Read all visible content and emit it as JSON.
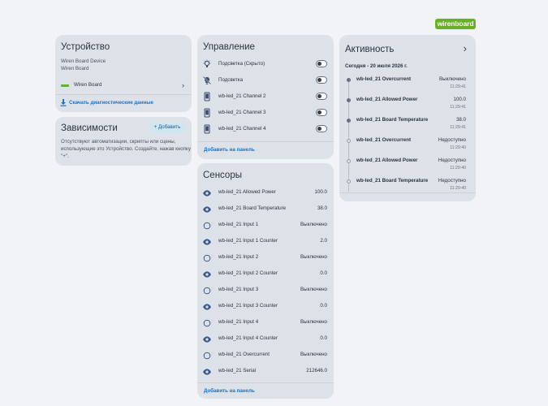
{
  "logo": {
    "text": "wirenboard",
    "color": "#6ab024"
  },
  "device": {
    "title": "Устройство",
    "model": "Wiren Board Device",
    "manufacturer": "Wiren Board",
    "link_label": "Wiren Board",
    "diagnostics_label": "Скачать диагностические данные"
  },
  "dependencies": {
    "title": "Зависимости",
    "add_label": "+ Добавить",
    "text_line1": "Отсутствуют автоматизации, скрипты или сцены,",
    "text_line2": "использующие это Устройство. Создайте, нажав кнопку",
    "text_line3": "\"+\"."
  },
  "control": {
    "title": "Управление",
    "items": [
      {
        "label": "Подсветка (Скрыто)",
        "icon": "lightbulb-outline-icon"
      },
      {
        "label": "Подсветка",
        "icon": "lightbulb-off-icon"
      },
      {
        "label": "wb-led_21 Channel 2",
        "icon": "phone-device-icon"
      },
      {
        "label": "wb-led_21 Channel 3",
        "icon": "phone-device-icon"
      },
      {
        "label": "wb-led_21 Channel 4",
        "icon": "phone-device-icon"
      }
    ],
    "add_to_panel": "Добавить на панель"
  },
  "sensors": {
    "title": "Сенсоры",
    "items": [
      {
        "label": "wb-led_21 Allowed Power",
        "value": "100.0",
        "icon": "eye-icon"
      },
      {
        "label": "wb-led_21 Board Temperature",
        "value": "38.0",
        "icon": "eye-icon"
      },
      {
        "label": "wb-led_21 Input 1",
        "value": "Выключено",
        "icon": "circle-outline-icon"
      },
      {
        "label": "wb-led_21 Input 1 Counter",
        "value": "2.0",
        "icon": "eye-icon"
      },
      {
        "label": "wb-led_21 Input 2",
        "value": "Выключено",
        "icon": "circle-outline-icon"
      },
      {
        "label": "wb-led_21 Input 2 Counter",
        "value": "0.0",
        "icon": "eye-icon"
      },
      {
        "label": "wb-led_21 Input 3",
        "value": "Выключено",
        "icon": "circle-outline-icon"
      },
      {
        "label": "wb-led_21 Input 3 Counter",
        "value": "0.0",
        "icon": "eye-icon"
      },
      {
        "label": "wb-led_21 Input 4",
        "value": "Выключено",
        "icon": "circle-outline-icon"
      },
      {
        "label": "wb-led_21 Input 4 Counter",
        "value": "0.0",
        "icon": "eye-icon"
      },
      {
        "label": "wb-led_21 Overcurrent",
        "value": "Выключено",
        "icon": "circle-outline-icon"
      },
      {
        "label": "wb-led_21 Serial",
        "value": "212646.0",
        "icon": "eye-icon"
      }
    ],
    "add_to_panel": "Добавить на панель"
  },
  "activity": {
    "title": "Активность",
    "date_header": "Сегодня - 20 июля 2026 г.",
    "items": [
      {
        "name": "wb-led_21 Overcurrent",
        "state": "Выключено",
        "time": "11:29:41",
        "dot": "filled"
      },
      {
        "name": "wb-led_21 Allowed Power",
        "state": "100.0",
        "time": "11:29:41",
        "dot": "filled"
      },
      {
        "name": "wb-led_21 Board Temperature",
        "state": "38.0",
        "time": "11:29:41",
        "dot": "filled"
      },
      {
        "name": "wb-led_21 Overcurrent",
        "state": "Недоступно",
        "time": "11:29:40",
        "dot": "hollow"
      },
      {
        "name": "wb-led_21 Allowed Power",
        "state": "Недоступно",
        "time": "11:29:40",
        "dot": "hollow"
      },
      {
        "name": "wb-led_21 Board Temperature",
        "state": "Недоступно",
        "time": "11:29:40",
        "dot": "hollow"
      }
    ]
  }
}
